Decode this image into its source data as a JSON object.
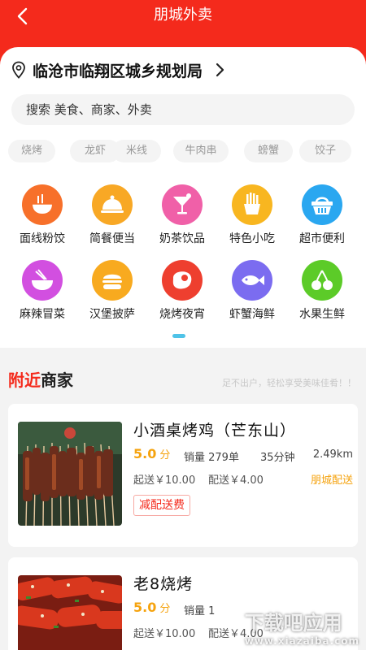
{
  "header": {
    "title": "朋城外卖",
    "back_icon": "back-arrow-icon"
  },
  "location": {
    "text": "临沧市临翔区城乡规划局",
    "icon": "location-pin-icon"
  },
  "search": {
    "placeholder": "搜索 美食、商家、外卖"
  },
  "hot_tags": [
    "烧烤",
    "龙虾",
    "米线",
    "牛肉串",
    "螃蟹",
    "饺子"
  ],
  "categories": [
    {
      "label": "面线粉饺",
      "icon": "noodle-bowl-icon",
      "color": "#f7702a"
    },
    {
      "label": "简餐便当",
      "icon": "food-cloche-icon",
      "color": "#f8a825"
    },
    {
      "label": "奶茶饮品",
      "icon": "cocktail-icon",
      "color": "#f060a8"
    },
    {
      "label": "特色小吃",
      "icon": "fries-icon",
      "color": "#f8b620"
    },
    {
      "label": "超市便利",
      "icon": "basket-icon",
      "color": "#2aa7f0"
    },
    {
      "label": "麻辣冒菜",
      "icon": "hotpot-bowl-icon",
      "color": "#d24fe0"
    },
    {
      "label": "汉堡披萨",
      "icon": "burger-icon",
      "color": "#f8aa1f"
    },
    {
      "label": "烧烤夜宵",
      "icon": "steak-icon",
      "color": "#ee3f2f"
    },
    {
      "label": "虾蟹海鲜",
      "icon": "fish-icon",
      "color": "#7b6cf0"
    },
    {
      "label": "水果生鲜",
      "icon": "cherry-icon",
      "color": "#5ccb28"
    }
  ],
  "nearby": {
    "title_red": "附近",
    "title_rest": "商家",
    "subtitle": "足不出户，轻松享受美味佳肴！！"
  },
  "shops": [
    {
      "name": "小酒桌烤鸡（芒东山）",
      "score": "5.0",
      "score_unit": "分",
      "sales": "销量 279单",
      "time": "35分钟",
      "distance": "2.49km",
      "min_price": "起送￥10.00",
      "delivery_fee": "配送￥4.00",
      "delivery": "朋城配送",
      "promo": "减配送费"
    },
    {
      "name": "老8烧烤",
      "score": "5.0",
      "score_unit": "分",
      "sales": "销量 1",
      "time": "",
      "distance": "",
      "min_price": "起送￥10.00",
      "delivery_fee": "配送￥4.00",
      "delivery": "",
      "promo": ""
    }
  ],
  "watermark": {
    "text": "下载吧应用",
    "url": "www.xiazaiba.com"
  }
}
